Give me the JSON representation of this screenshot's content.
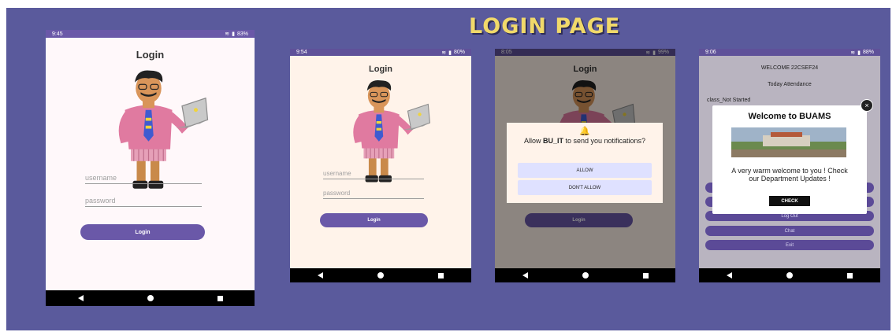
{
  "page": {
    "heading": "LOGIN PAGE"
  },
  "phones": {
    "p1": {
      "status": {
        "time": "9:45",
        "battery": "83%"
      },
      "title": "Login",
      "username_placeholder": "username",
      "password_placeholder": "password",
      "login_button": "Login"
    },
    "p2": {
      "status": {
        "time": "9:54",
        "battery": "80%"
      },
      "title": "Login",
      "username_placeholder": "username",
      "password_placeholder": "password",
      "login_button": "Login"
    },
    "p3": {
      "status": {
        "time": "8:05",
        "battery": "99%"
      },
      "title": "Login",
      "login_button": "Login",
      "dialog": {
        "message_prefix": "Allow ",
        "app_name": "BU_IT",
        "message_suffix": " to send you notifications?",
        "allow": "ALLOW",
        "deny": "DON'T ALLOW"
      }
    },
    "p4": {
      "status": {
        "time": "9:06",
        "battery": "88%"
      },
      "welcome": "WELCOME 22CSEF24",
      "attendance": "Today Attendance",
      "class_status": "class_Not Started",
      "menu": [
        "Log Out",
        "Chat",
        "Exit"
      ],
      "popup": {
        "title": "Welcome to BUAMS",
        "message": "A very warm welcome to you ! Check our Department Updates !",
        "button": "CHECK"
      }
    }
  },
  "colors": {
    "frame": "#5a5a9c",
    "accent": "#6a58a8",
    "heading": "#f1d96a"
  },
  "icons": [
    "wifi-icon",
    "battery-icon",
    "nav-back-icon",
    "nav-home-icon",
    "nav-recent-icon",
    "bell-icon",
    "close-icon"
  ]
}
